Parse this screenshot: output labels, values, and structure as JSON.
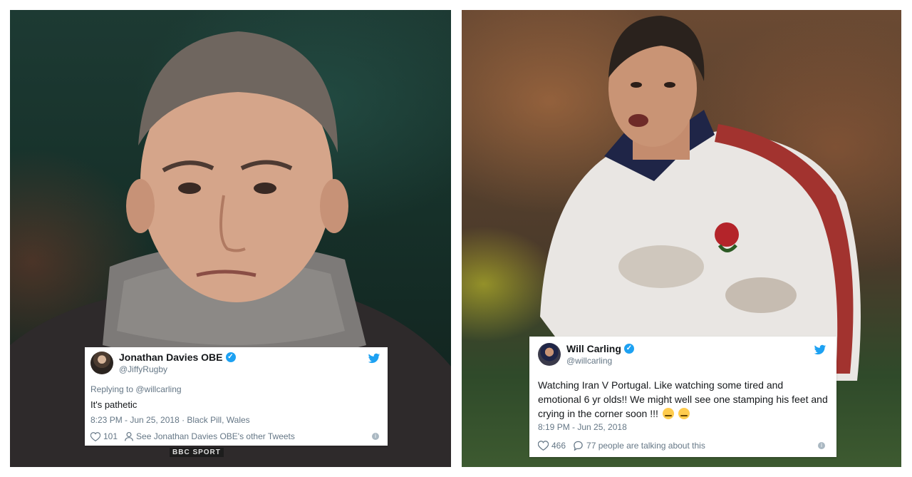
{
  "left_tweet": {
    "name": "Jonathan Davies OBE",
    "handle": "@JiffyRugby",
    "replying_to": "Replying to @willcarling",
    "text": "It's pathetic",
    "meta": "8:23 PM - Jun 25, 2018 · Black Pill, Wales",
    "likes": "101",
    "other_tweets": "See Jonathan Davies OBE's other Tweets"
  },
  "right_tweet": {
    "name": "Will Carling",
    "handle": "@willcarling",
    "text": "Watching Iran V Portugal. Like watching some tired and emotional 6 yr olds!! We might well see one stamping his feet and crying in the corner soon !!!",
    "meta": "8:19 PM - Jun 25, 2018",
    "likes": "466",
    "talking": "77 people are talking about this"
  },
  "left_photo": {
    "logo_text": "BBC SPORT"
  },
  "colors": {
    "twitter_blue": "#1da1f2",
    "text_gray": "#657786",
    "verified": "#1da1f2"
  },
  "icons": [
    "twitter-bird-icon",
    "verified-icon",
    "heart-icon",
    "person-icon",
    "comment-icon",
    "info-icon"
  ]
}
